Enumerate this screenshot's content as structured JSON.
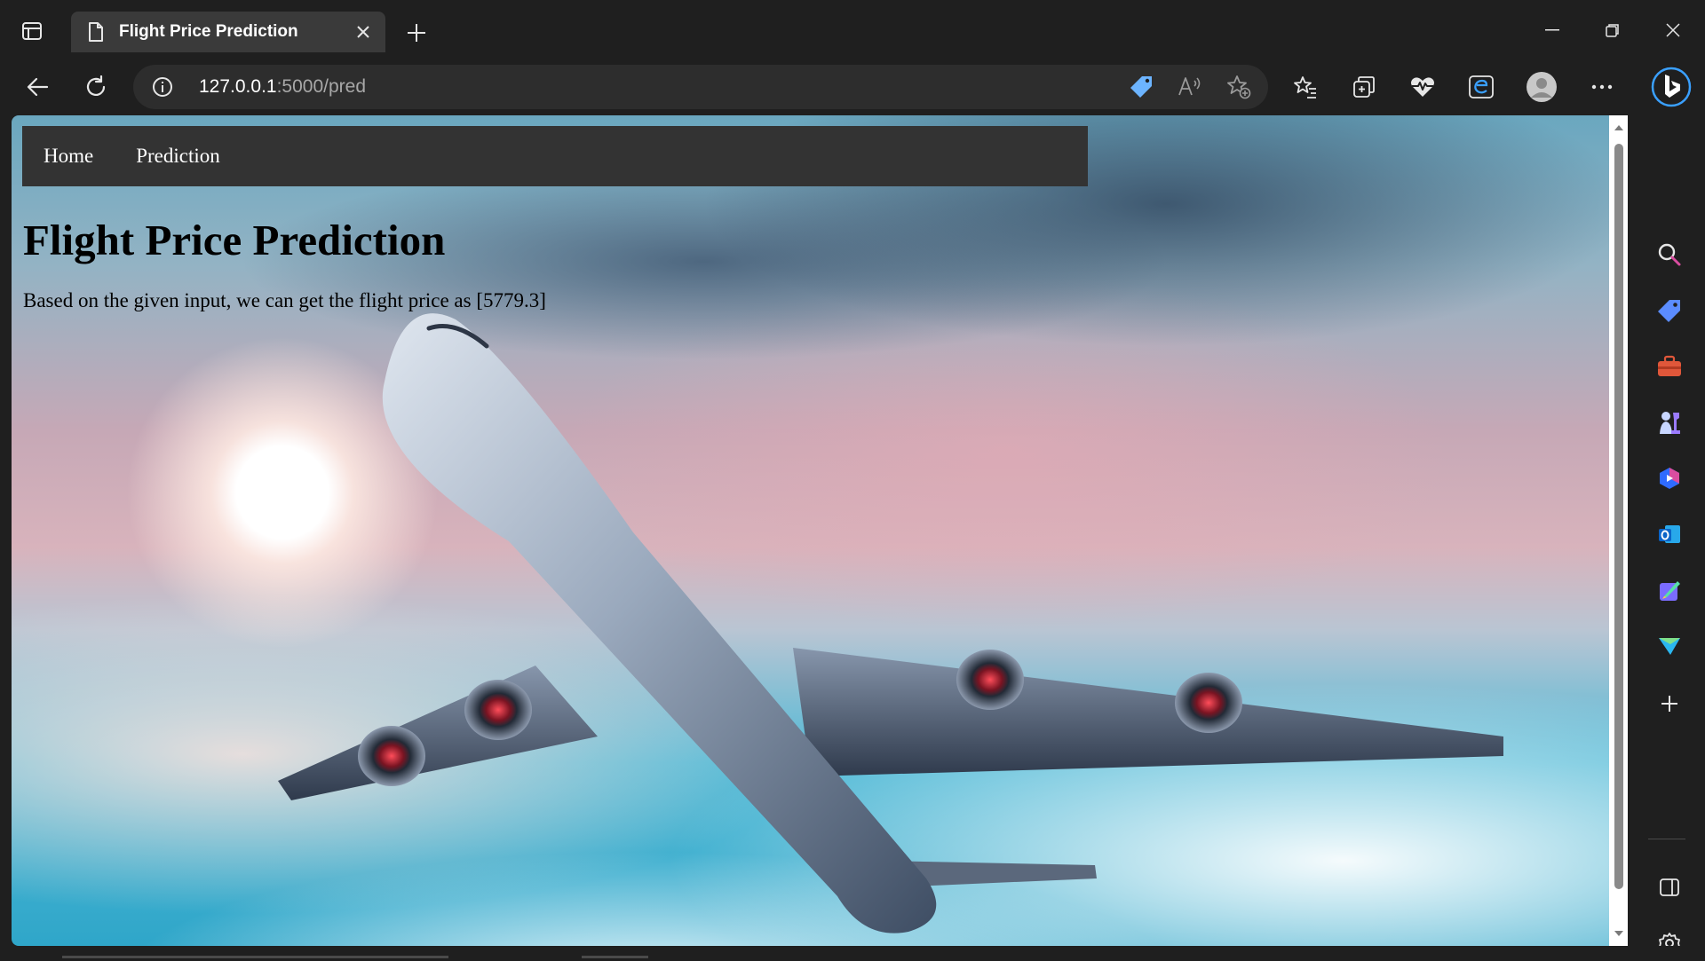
{
  "browser": {
    "tab": {
      "title": "Flight Price Prediction"
    },
    "address_bar": {
      "host": "127.0.0.1",
      "path": ":5000/pred"
    }
  },
  "page": {
    "nav": [
      {
        "label": "Home"
      },
      {
        "label": "Prediction"
      }
    ],
    "heading": "Flight Price Prediction",
    "result_text": "Based on the given input, we can get the flight price as [5779.3]"
  },
  "icons": {
    "tab_actions": "tab-actions-icon",
    "page": "page-icon",
    "close": "close-icon",
    "new_tab": "plus-icon",
    "minimize": "minimize-icon",
    "restore": "restore-icon",
    "window_close": "close-icon",
    "back": "back-arrow-icon",
    "refresh": "refresh-icon",
    "site_info": "info-icon",
    "coupon": "tag-icon",
    "read_aloud": "read-aloud-icon",
    "add_favorite": "star-plus-icon",
    "favorites": "favorites-icon",
    "collections": "collections-icon",
    "browser_essentials": "heartbeat-icon",
    "edge_ext": "edge-e-icon",
    "profile": "profile-icon",
    "more": "ellipsis-icon",
    "copilot": "bing-copilot-icon"
  },
  "colors": {
    "browser_chrome": "#1f1f1f",
    "active_tab": "#3a3a3a",
    "site_nav": "#333333",
    "accent": "#3aa0ff"
  }
}
